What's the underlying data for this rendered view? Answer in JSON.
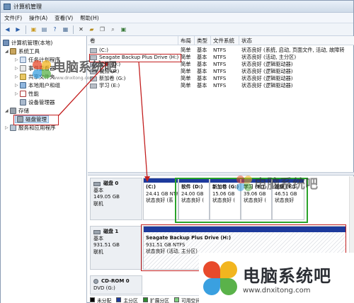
{
  "window": {
    "title": "计算机管理"
  },
  "menu": [
    "文件(F)",
    "操作(A)",
    "查看(V)",
    "帮助(H)"
  ],
  "toolbar_icons": [
    "back-icon",
    "forward-icon",
    "up-folder-icon",
    "show-hide-tree-icon",
    "help-icon",
    "properties-icon",
    "delete-icon",
    "cut-icon",
    "copy-icon",
    "search-icon",
    "info-icon"
  ],
  "tree": {
    "root": "计算机管理(本地)",
    "system_tools": "系统工具",
    "task_scheduler": "任务计划程序",
    "event_viewer": "事件查看器",
    "shared_folders": "共享文件夹",
    "local_users": "本地用户和组",
    "performance": "性能",
    "device_manager": "设备管理器",
    "storage": "存储",
    "disk_management": "磁盘管理",
    "services": "服务和应用程序"
  },
  "volume_table": {
    "headers": [
      "卷",
      "布局",
      "类型",
      "文件系统",
      "状态"
    ],
    "rows": [
      {
        "volume": "(C:)",
        "layout": "简单",
        "type": "基本",
        "fs": "NTFS",
        "status": "状态良好 (系统, 启动, 页面文件, 活动, 故障转"
      },
      {
        "volume": "Seagate Backup Plus Drive (H:)",
        "layout": "简单",
        "type": "基本",
        "fs": "NTFS",
        "status": "状态良好 (活动, 主分区)"
      },
      {
        "volume": "软件 (D:)",
        "layout": "简单",
        "type": "基本",
        "fs": "NTFS",
        "status": "状态良好 (逻辑驱动器)"
      },
      {
        "volume": "视频 (F:)",
        "layout": "简单",
        "type": "基本",
        "fs": "NTFS",
        "status": "状态良好 (逻辑驱动器)"
      },
      {
        "volume": "新加卷 (G:)",
        "layout": "简单",
        "type": "基本",
        "fs": "NTFS",
        "status": "状态良好 (逻辑驱动器)"
      },
      {
        "volume": "学习 (E:)",
        "layout": "简单",
        "type": "基本",
        "fs": "NTFS",
        "status": "状态良好 (逻辑驱动器)"
      }
    ]
  },
  "disk0": {
    "name": "磁盘 0",
    "type": "基本",
    "size": "149.05 GB",
    "state": "联机",
    "partitions": [
      {
        "label": "(C:)",
        "size": "24.41 GB NTFS",
        "status": "状态良好 (系"
      },
      {
        "label": "软件 (D:)",
        "size": "24.00 GB",
        "status": "状态良好 ("
      },
      {
        "label": "新加卷 (G:)",
        "size": "15.06 GB",
        "status": "状态良好 ("
      },
      {
        "label": "学习 (E:)",
        "size": "39.06 GB",
        "status": "状态良好 ("
      },
      {
        "label": "视频 (F:)",
        "size": "46.51 GB",
        "status": "状态良好"
      }
    ]
  },
  "disk1": {
    "name": "磁盘 1",
    "type": "基本",
    "size": "931.51 GB",
    "state": "联机",
    "partition": {
      "label": "Seagate Backup Plus Drive  (H:)",
      "size": "931.51 GB NTFS",
      "status": "状态良好 (活动, 主分区)"
    }
  },
  "cdrom": {
    "name": "CD-ROM 0",
    "drive": "DVD (G:)"
  },
  "legend": [
    "未分配",
    "主分区",
    "扩展分区",
    "可用空间"
  ],
  "legend_colors": [
    "#000000",
    "#1d3a9c",
    "#2f8a2f",
    "#7fd07f"
  ],
  "watermark": {
    "brand": "电脑系统吧",
    "url": "www.dnxitong.com",
    "url_small": "www.dnxitong.com"
  },
  "accent_colors": {
    "highlight_red": "#c32020",
    "highlight_green": "#2aa32a",
    "primary_partition": "#1d3a9c"
  }
}
